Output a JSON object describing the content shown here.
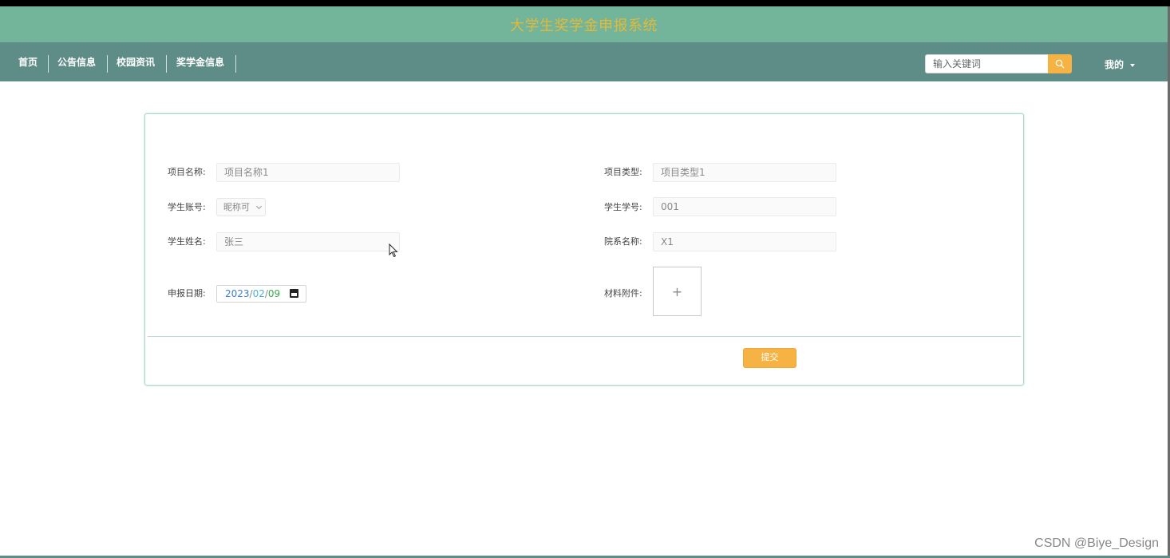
{
  "app": {
    "title": "大学生奖学金申报系统"
  },
  "nav": {
    "items": [
      {
        "label": "首页"
      },
      {
        "label": "公告信息"
      },
      {
        "label": "校园资讯"
      },
      {
        "label": "奖学金信息"
      }
    ],
    "search": {
      "placeholder": "输入关键词",
      "icon": "search-icon"
    },
    "user_menu": {
      "label": "我的",
      "icon": "caret-down-icon"
    }
  },
  "form": {
    "project_name": {
      "label": "项目名称:",
      "value": "项目名称1"
    },
    "project_type": {
      "label": "项目类型:",
      "value": "项目类型1"
    },
    "student_account": {
      "label": "学生账号:",
      "value": "昵称可"
    },
    "student_id": {
      "label": "学生学号:",
      "value": "001"
    },
    "student_name": {
      "label": "学生姓名:",
      "value": "张三"
    },
    "department": {
      "label": "院系名称:",
      "value": "X1"
    },
    "apply_date": {
      "label": "申报日期:",
      "year": "2023",
      "month": "02",
      "day": "09",
      "sep": "/",
      "icon": "calendar-icon"
    },
    "attachment": {
      "label": "材料附件:",
      "upload_symbol": "+"
    },
    "submit_label": "提交"
  },
  "colors": {
    "title_bar": "#73b59a",
    "nav_bar": "#5e8c86",
    "title_text": "#e3b93a",
    "accent": "#f7b244"
  },
  "watermark": "CSDN @Biye_Design"
}
